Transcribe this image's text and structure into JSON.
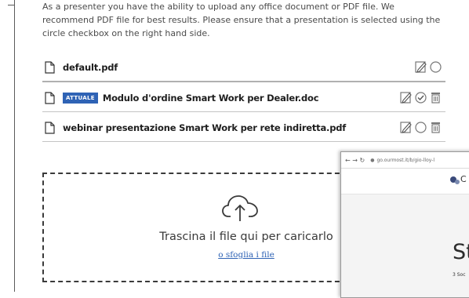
{
  "intro_text": "As a presenter you have the ability to upload any office document or PDF file. We recommend PDF file for best results. Please ensure that a presentation is selected using the circle checkbox on the right hand side.",
  "files": [
    {
      "name": "default.pdf",
      "badge": "",
      "selected": false,
      "deletable": false
    },
    {
      "name": "Modulo d'ordine Smart Work per Dealer.doc",
      "badge": "ATTUALE",
      "selected": true,
      "deletable": true
    },
    {
      "name": "webinar presentazione Smart Work per rete indiretta.pdf",
      "badge": "",
      "selected": false,
      "deletable": true
    }
  ],
  "dropzone": {
    "title": "Trascina il file qui per caricarlo",
    "link": "o sfoglia i file"
  },
  "overlay": {
    "url": "go.ourmost.it/b/gio-lloy-l",
    "logo_text": "C",
    "big_text": "St",
    "small_text": "3 Soc"
  },
  "colors": {
    "badge_bg": "#2f63b5",
    "link": "#2f63b5",
    "dropzone_border": "#3a3a3a"
  }
}
